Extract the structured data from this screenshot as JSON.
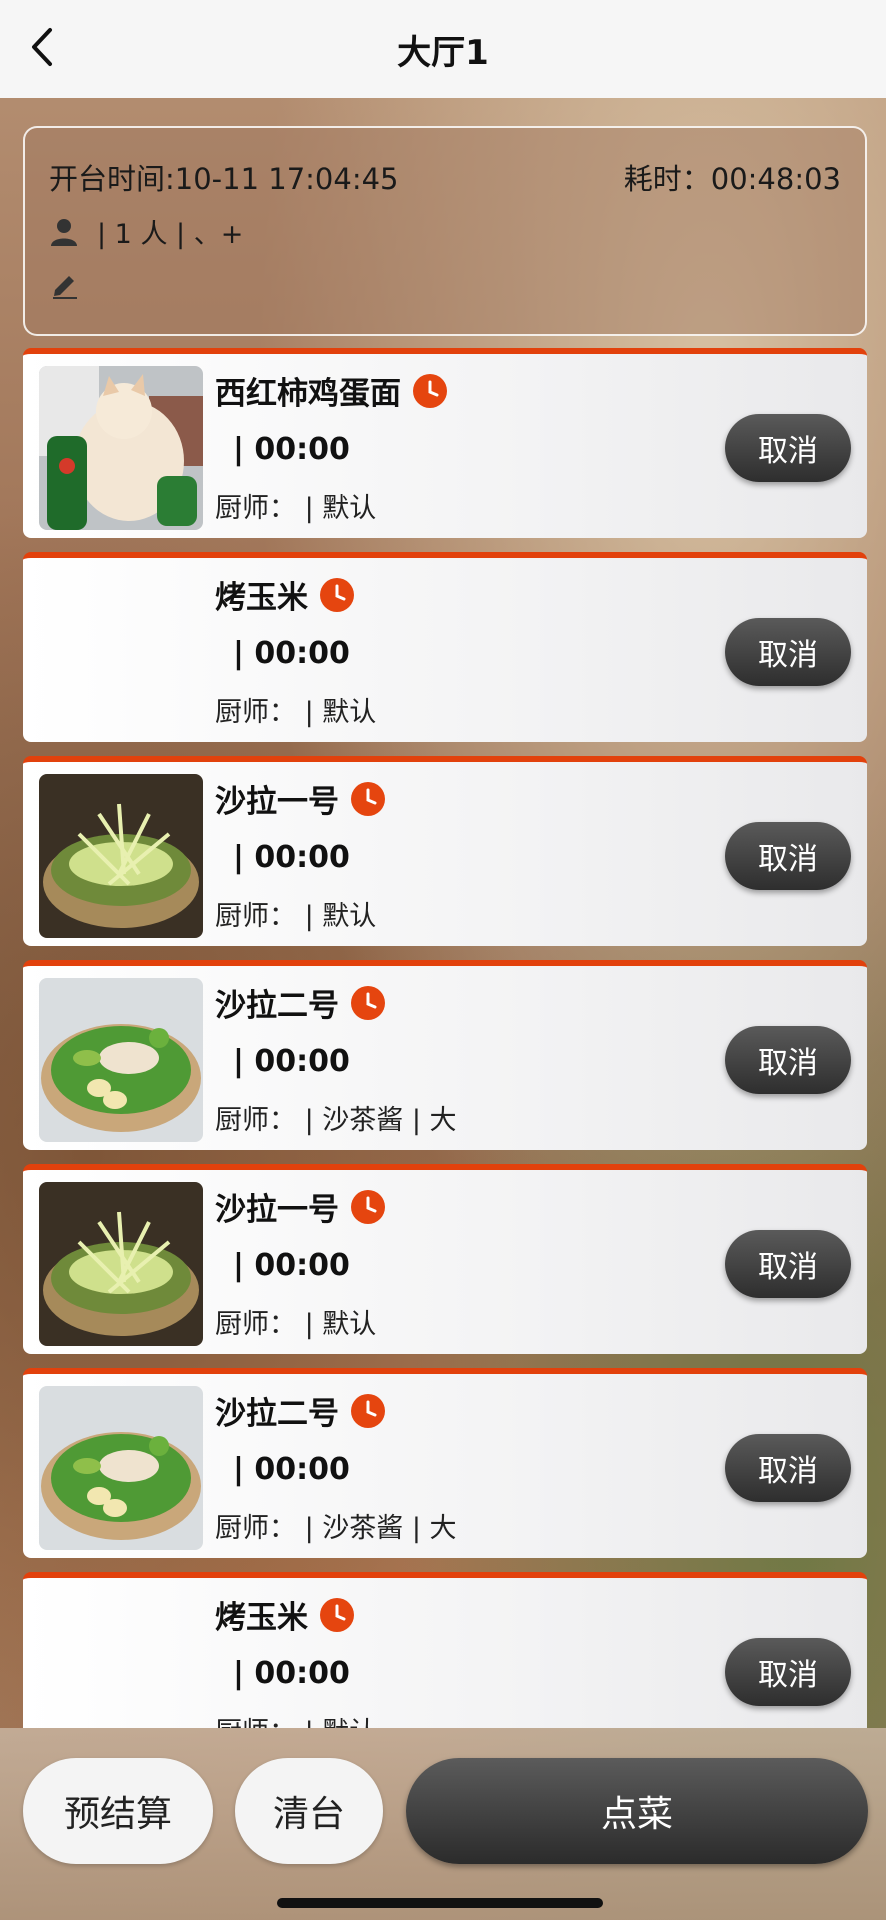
{
  "header": {
    "title": "大厅1",
    "back_icon": "chevron-left-icon"
  },
  "info": {
    "open_time": "开台时间:10-11 17:04:45",
    "elapsed": "耗时：00:48:03",
    "people": "| 1 人 | 、+",
    "person_icon": "person-icon",
    "edit_icon": "pencil-icon"
  },
  "orders": [
    {
      "name": "西红柿鸡蛋面",
      "time": "| 00:00",
      "chef": "厨师： | 默认",
      "cancel": "取消",
      "image": "cat-photo"
    },
    {
      "name": "烤玉米",
      "time": "| 00:00",
      "chef": "厨师： | 默认",
      "cancel": "取消",
      "image": ""
    },
    {
      "name": "沙拉一号",
      "time": "| 00:00",
      "chef": "厨师： | 默认",
      "cancel": "取消",
      "image": "noodle-salad"
    },
    {
      "name": "沙拉二号",
      "time": "| 00:00",
      "chef": "厨师： | 沙茶酱 | 大",
      "cancel": "取消",
      "image": "green-salad"
    },
    {
      "name": "沙拉一号",
      "time": "| 00:00",
      "chef": "厨师： | 默认",
      "cancel": "取消",
      "image": "noodle-salad"
    },
    {
      "name": "沙拉二号",
      "time": "| 00:00",
      "chef": "厨师： | 沙茶酱 | 大",
      "cancel": "取消",
      "image": "green-salad"
    },
    {
      "name": "烤玉米",
      "time": "| 00:00",
      "chef": "厨师： | 默认",
      "cancel": "取消",
      "image": ""
    }
  ],
  "footer": {
    "pre_settle": "预结算",
    "clear_table": "清台",
    "order_dish": "点菜"
  },
  "colors": {
    "accent": "#e2410c",
    "dark_button": "#2e2e2e"
  }
}
